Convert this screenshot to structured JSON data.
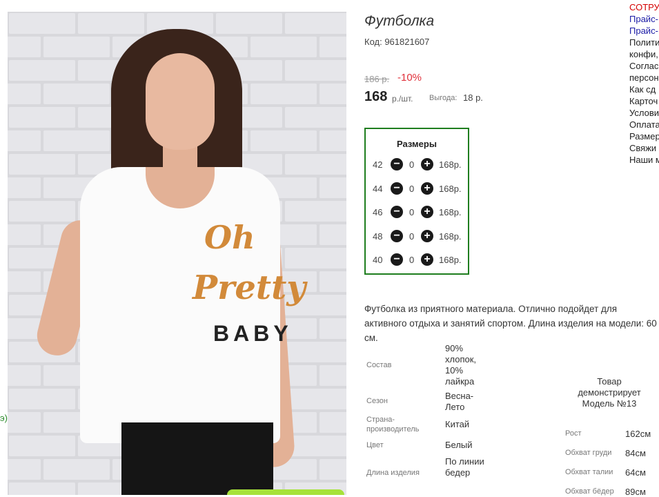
{
  "product": {
    "title": "Футболка",
    "code": "Код: 961821607",
    "old_price": "186 р.",
    "discount": "-10%",
    "price": "168",
    "unit": "р./шт.",
    "benefit_label": "Выгода:",
    "benefit_value": "18 р."
  },
  "photo": {
    "print_line1": "Oh",
    "print_line2": "Pretty",
    "print_line3": "BABY",
    "left_edge_text": "э)"
  },
  "sizes": {
    "title": "Размеры",
    "rows": [
      {
        "size": "42",
        "qty": "0",
        "price": "168р."
      },
      {
        "size": "44",
        "qty": "0",
        "price": "168р."
      },
      {
        "size": "46",
        "qty": "0",
        "price": "168р."
      },
      {
        "size": "48",
        "qty": "0",
        "price": "168р."
      },
      {
        "size": "40",
        "qty": "0",
        "price": "168р."
      }
    ],
    "minus_symbol": "−",
    "plus_symbol": "+"
  },
  "description": "Футболка из приятного материала. Отлично подойдет для активного отдыха и занятий спортом. Длина изделия на модели: 60 см.",
  "properties": [
    {
      "label": "Состав",
      "value": "90% хлопок, 10% лайкра"
    },
    {
      "label": "Сезон",
      "value": "Весна-Лето"
    },
    {
      "label": "Страна-производитель",
      "value": "Китай"
    },
    {
      "label": "Цвет",
      "value": "Белый"
    },
    {
      "label": "Длина изделия",
      "value": "По линии бедер"
    }
  ],
  "model": {
    "caption": "Товар демонстрирует Модель №13",
    "measures": [
      {
        "label": "Рост",
        "value": "162см"
      },
      {
        "label": "Обхват груди",
        "value": "84см"
      },
      {
        "label": "Обхват талии",
        "value": "64см"
      },
      {
        "label": "Обхват бёдер",
        "value": "89см"
      }
    ]
  },
  "right_links": [
    {
      "text": "СОТРУ,",
      "color": "#d40000"
    },
    {
      "text": "Прайс-",
      "color": "#1a1aa6"
    },
    {
      "text": "Прайс-",
      "color": "#1a1aa6"
    },
    {
      "text": "Полити",
      "color": "#222222"
    },
    {
      "text": "конфи,",
      "color": "#222222"
    },
    {
      "text": "Соглас",
      "color": "#222222"
    },
    {
      "text": "персон",
      "color": "#222222"
    },
    {
      "text": "Как сд",
      "color": "#222222"
    },
    {
      "text": "Карточ",
      "color": "#222222"
    },
    {
      "text": "Услови",
      "color": "#222222"
    },
    {
      "text": "Оплата",
      "color": "#222222"
    },
    {
      "text": "Размер",
      "color": "#222222"
    },
    {
      "text": "Свяжи",
      "color": "#222222"
    },
    {
      "text": "Наши м",
      "color": "#222222"
    }
  ]
}
